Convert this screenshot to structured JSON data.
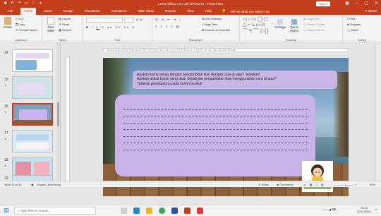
{
  "window": {
    "title": "LKPD Siklus II CA SR MARLIAN  -  PowerPoint",
    "sign_in": "Sign in",
    "share": "Share"
  },
  "tabs": [
    "File",
    "Home",
    "Insert",
    "Design",
    "Transitions",
    "Animations",
    "Slide Show",
    "Review",
    "View",
    "Help"
  ],
  "tell_me": "Tell me what you want to do",
  "ribbon": {
    "clipboard": {
      "paste": "Paste",
      "cut": "Cut",
      "copy": "Copy",
      "format_painter": "Format Painter",
      "label": "Clipboard"
    },
    "slides": {
      "new_slide": "New Slide",
      "layout": "Layout",
      "reset": "Reset",
      "section": "Section",
      "label": "Slides"
    },
    "font": {
      "label": "Font"
    },
    "paragraph": {
      "text_direction": "Text Direction",
      "align_text": "Align Text",
      "convert_smartart": "Convert to SmartArt",
      "label": "Paragraph"
    },
    "drawing": {
      "arrange": "Arrange",
      "quick_styles": "Quick Styles",
      "shape_fill": "Shape Fill",
      "shape_outline": "Shape Outline",
      "shape_effects": "Shape Effects",
      "label": "Drawing"
    },
    "editing": {
      "find": "Find",
      "replace": "Replace",
      "select": "Select",
      "label": "Editing"
    }
  },
  "ruler_text": "16 | 15 | 14 | 13 | 12 | 11 | 10 | 9 | 8 | 7 | 6 | 5 | 4 | 3 | 2 | 1 | 0 | 1 | 2 | 3 | 4 | 5 | 6 | 7 | 8 | 9 | 10 | 11 | 12 | 13 | 14 | 15 | 16",
  "thumbnails": [
    {
      "num": "14"
    },
    {
      "num": "15"
    },
    {
      "num": "16"
    },
    {
      "num": "17"
    },
    {
      "num": "18"
    },
    {
      "num": "19"
    }
  ],
  "slide": {
    "questions": [
      "Apakah kamu setuju dengan pengambilan ikan dengan cara di atas? Jelaskan!",
      "Apakah akibat buruk yang akan terjadi jika pengambilan ikan menggunakan cara di atas?",
      "Tuliskan pendapatmu pada kolom berikut!"
    ]
  },
  "status": {
    "slide_info": "Slide 16 of 19",
    "language": "English (Indonesia)",
    "notes": "Notes",
    "comments": "Comments",
    "zoom": "69%"
  },
  "taskbar": {
    "search_placeholder": "Type here to search",
    "time": "20:40",
    "date": "22/11/2020"
  },
  "colors": {
    "accent": "#c43e1c",
    "question_box": "#c9b6e6",
    "answer_box": "#c7b2ea"
  }
}
